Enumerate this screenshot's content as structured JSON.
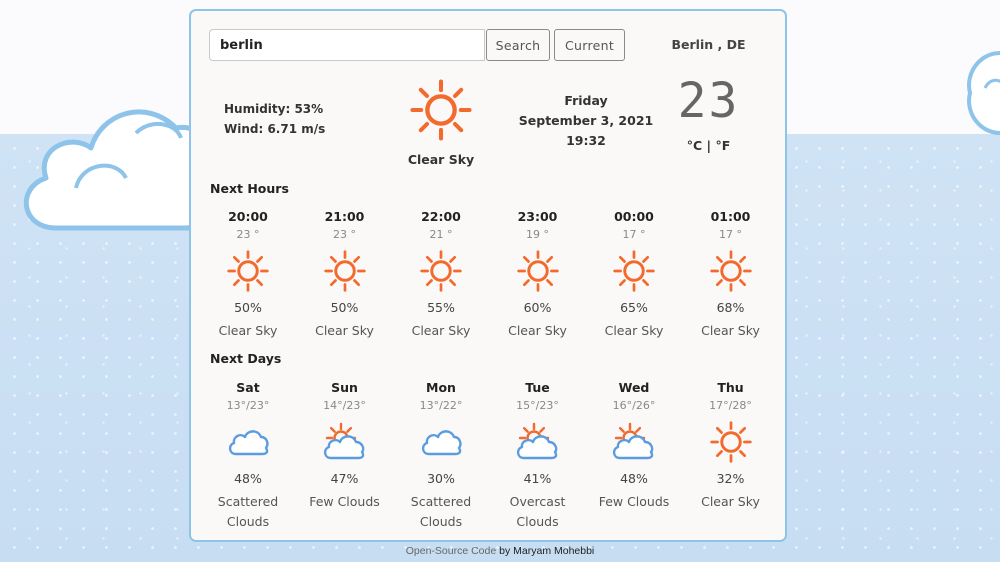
{
  "search": {
    "value": "berlin",
    "search_label": "Search",
    "current_label": "Current"
  },
  "city": "Berlin , DE",
  "current": {
    "humidity": "Humidity: 53%",
    "wind": "Wind: 6.71 m/s",
    "icon": "sun-icon",
    "description": "Clear Sky",
    "day": "Friday",
    "date": "September 3, 2021",
    "time": "19:32",
    "temperature": "23",
    "unit_c": "°C",
    "unit_sep": "|",
    "unit_f": "°F"
  },
  "hours_title": "Next Hours",
  "hours": [
    {
      "time": "20:00",
      "temp": "23 °",
      "icon": "sun-icon",
      "pct": "50%",
      "desc": "Clear Sky"
    },
    {
      "time": "21:00",
      "temp": "23 °",
      "icon": "sun-icon",
      "pct": "50%",
      "desc": "Clear Sky"
    },
    {
      "time": "22:00",
      "temp": "21 °",
      "icon": "sun-icon",
      "pct": "55%",
      "desc": "Clear Sky"
    },
    {
      "time": "23:00",
      "temp": "19 °",
      "icon": "sun-icon",
      "pct": "60%",
      "desc": "Clear Sky"
    },
    {
      "time": "00:00",
      "temp": "17 °",
      "icon": "sun-icon",
      "pct": "65%",
      "desc": "Clear Sky"
    },
    {
      "time": "01:00",
      "temp": "17 °",
      "icon": "sun-icon",
      "pct": "68%",
      "desc": "Clear Sky"
    }
  ],
  "days_title": "Next Days",
  "days": [
    {
      "day": "Sat",
      "temp": "13°/23°",
      "icon": "cloud-icon",
      "pct": "48%",
      "desc": "Scattered Clouds"
    },
    {
      "day": "Sun",
      "temp": "14°/23°",
      "icon": "sun-cloud-icon",
      "pct": "47%",
      "desc": "Few Clouds"
    },
    {
      "day": "Mon",
      "temp": "13°/22°",
      "icon": "cloud-icon",
      "pct": "30%",
      "desc": "Scattered Clouds"
    },
    {
      "day": "Tue",
      "temp": "15°/23°",
      "icon": "sun-cloud-icon",
      "pct": "41%",
      "desc": "Overcast Clouds"
    },
    {
      "day": "Wed",
      "temp": "16°/26°",
      "icon": "sun-cloud-icon",
      "pct": "48%",
      "desc": "Few Clouds"
    },
    {
      "day": "Thu",
      "temp": "17°/28°",
      "icon": "sun-icon",
      "pct": "32%",
      "desc": "Clear Sky"
    }
  ],
  "footer": {
    "text": "Open-Source Code",
    "by": "by",
    "author": "Maryam Mohebbi"
  },
  "colors": {
    "sun": "#f26a2e",
    "cloud": "#5b9be0",
    "card_border": "#8ec3ea",
    "bg_sky": "#c7ddf2"
  }
}
